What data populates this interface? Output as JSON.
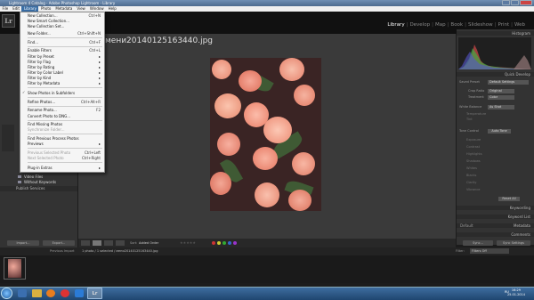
{
  "window": {
    "title": "Lightroom 4 Catalog - Adobe Photoshop Lightroom - Library"
  },
  "menubar": [
    "File",
    "Edit",
    "Library",
    "Photo",
    "Metadata",
    "View",
    "Window",
    "Help"
  ],
  "modules": [
    "Library",
    "Develop",
    "Map",
    "Book",
    "Slideshow",
    "Print",
    "Web"
  ],
  "active_module": "Library",
  "center": {
    "filename": "мени20140125163440.jpg"
  },
  "library_menu": [
    {
      "label": "New Collection...",
      "shortcut": "Ctrl+N"
    },
    {
      "label": "New Smart Collection...",
      "shortcut": ""
    },
    {
      "label": "New Collection Set...",
      "shortcut": ""
    },
    {
      "label": "New Folder...",
      "shortcut": "Ctrl+Shift+N"
    },
    {
      "label": "Find...",
      "shortcut": "Ctrl+F"
    },
    {
      "label": "Enable Filters",
      "shortcut": "Ctrl+L"
    },
    {
      "label": "Filter by Preset",
      "shortcut": ""
    },
    {
      "label": "Filter by Flag",
      "shortcut": ""
    },
    {
      "label": "Filter by Rating",
      "shortcut": ""
    },
    {
      "label": "Filter by Color Label",
      "shortcut": ""
    },
    {
      "label": "Filter by Kind",
      "shortcut": ""
    },
    {
      "label": "Filter by Metadata",
      "shortcut": ""
    },
    {
      "label": "Show Photos in Subfolders",
      "shortcut": ""
    },
    {
      "label": "Refine Photos...",
      "shortcut": "Ctrl+Alt+R"
    },
    {
      "label": "Rename Photo...",
      "shortcut": "F2"
    },
    {
      "label": "Convert Photo to DNG...",
      "shortcut": ""
    },
    {
      "label": "Find Missing Photos",
      "shortcut": ""
    },
    {
      "label": "Synchronize Folder...",
      "shortcut": ""
    },
    {
      "label": "Find Previous Process Photos",
      "shortcut": ""
    },
    {
      "label": "Previews",
      "shortcut": ""
    },
    {
      "label": "Previous Selected Photo",
      "shortcut": "Ctrl+Left"
    },
    {
      "label": "Next Selected Photo",
      "shortcut": "Ctrl+Right"
    },
    {
      "label": "Plug-in Extras",
      "shortcut": ""
    }
  ],
  "left_panel": {
    "collections": [
      "Video Files",
      "Without Keywords"
    ],
    "publish_header": "Publish Services",
    "import_label": "Import...",
    "export_label": "Export..."
  },
  "right_panel": {
    "histogram": "Histogram",
    "quick_develop": "Quick Develop",
    "saved_preset_label": "Saved Preset",
    "saved_preset_value": "Default Settings",
    "crop_label": "Crop Ratio",
    "crop_value": "Original",
    "treatment_label": "Treatment",
    "treatment_value": "Color",
    "wb_label": "White Balance",
    "wb_value": "As Shot",
    "tone_control": "Tone Control",
    "auto_tone": "Auto Tone",
    "tone_rows": [
      "Temperature",
      "Tint",
      "Exposure",
      "Contrast",
      "Highlights",
      "Shadows",
      "Whites",
      "Blacks",
      "Clarity",
      "Vibrance"
    ],
    "reset_all": "Reset All",
    "keywording": "Keywording",
    "keyword_list": "Keyword List",
    "metadata": "Metadata",
    "metadata_preset": "Default",
    "comments": "Comments",
    "sync": "Sync...",
    "sync_settings": "Sync Settings"
  },
  "toolbar": {
    "sort_label": "Sort:",
    "sort_value": "Added Order"
  },
  "filmstrip": {
    "prev_import": "Previous Import",
    "info": "1 photo / 1 selected / мени20140125163440.jpg",
    "filter_label": "Filter:",
    "filter_value": "Filters Off"
  },
  "taskbar": {
    "lang": "RU",
    "time": "16:29",
    "date": "25.01.2014"
  },
  "colors": {
    "menu_highlight": "#3a6ea5",
    "panel": "#333333",
    "background": "#3a3a3a"
  }
}
